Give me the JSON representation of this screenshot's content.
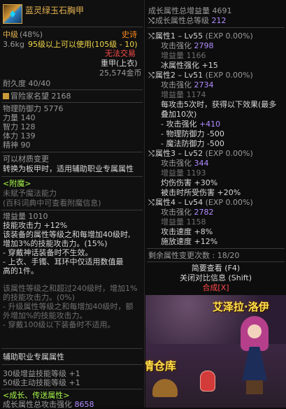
{
  "left": {
    "item_name": "蓝灵绿玉石胸甲",
    "grade": "中级",
    "grade_pct": "(48%)",
    "rarity": "史诗",
    "weight": "3.6kg",
    "level_req": "95级以上可以使用(105级 - 10)",
    "no_trade": "无法交易",
    "armor_type": "重甲(上衣)",
    "price": "25,574金币",
    "durability": "耐久度 40/40",
    "adventure_fame": "冒险家名望",
    "adventure_fame_value": "2168",
    "stats": [
      {
        "label": "物理防御力",
        "value": "5776"
      },
      {
        "label": "力量",
        "value": "140"
      },
      {
        "label": "智力",
        "value": "128"
      },
      {
        "label": "体力",
        "value": "139"
      },
      {
        "label": "精神",
        "value": "90"
      }
    ],
    "material_change": "可以材质变更",
    "convert": "转换为板甲时，适用辅助职业专属属性",
    "enchant_header": "<附魔>",
    "enchant_none": "未赋予魔法能力",
    "enchant_hint": "(百科词典中可查看附魔信息)",
    "bonus_label": "增益量",
    "bonus_value": "1010",
    "skill_atk": "技能攻击力 +12%",
    "desc_1": "该装备的属性等级之和每增加40级时,",
    "desc_2": "增加3%的技能攻击力。(15%)",
    "desc_3": "- 穿戴神话装备时不生效。",
    "desc_4": "- 上衣、手镯、耳环中仅适用数值最",
    "desc_5": "高的1件。",
    "desc_dim_1": "该属性等级之和超过240级时，增加1%",
    "desc_dim_2": "的技能攻击力。(0%)",
    "desc_dim_3": "- 升级属性等级之和每增加40级时，额",
    "desc_dim_4": "外增加%的技能攻击力。",
    "desc_dim_5": "- 穿戴100级以下装备时不适用。",
    "support_header": "辅助职业专属属性",
    "support_1": "30级增益技能等级 +1",
    "support_2": "50级主动技能等级 +1",
    "growth_header": "<成长、传送属性>",
    "growth_bottom": "成长属性总攻击强化",
    "growth_bottom_value": "8658"
  },
  "right": {
    "header_1": "成长属性总增益量",
    "header_1_value": "4691",
    "header_2": "成长属性总等级",
    "header_2_value": "212",
    "attr_1_title": "属性1 – Lv55",
    "attr_1_exp": "(EXP 0.00%)",
    "attr_1_atk_label": "攻击强化",
    "attr_1_atk": "2798",
    "attr_1_bonus_label": "增益量",
    "attr_1_bonus": "1166",
    "attr_1_effect": "冰属性强化 +15",
    "attr_2_title": "属性2 – Lv51",
    "attr_2_exp": "(EXP 0.00%)",
    "attr_2_atk_label": "攻击强化",
    "attr_2_atk": "2734",
    "attr_2_bonus_label": "增益量",
    "attr_2_bonus": "1174",
    "attr_2_effect_1": "每攻击5次时，获得以下效果(最多",
    "attr_2_effect_2": "叠加10次)",
    "attr_2_effect_3_label": "- 攻击强化",
    "attr_2_effect_3": "+410",
    "attr_2_effect_4": "- 物理防御力 -500",
    "attr_2_effect_5": "- 魔法防御力 -500",
    "attr_3_title": "属性3 – Lv52",
    "attr_3_exp": "(EXP 0.00%)",
    "attr_3_atk_label": "攻击强化",
    "attr_3_atk": "344",
    "attr_3_bonus_label": "增益量",
    "attr_3_bonus": "1193",
    "attr_3_effect_1": "灼伤伤害 +30%",
    "attr_3_effect_2": "被击时所受伤害 +20%",
    "attr_4_title": "属性4 – Lv54",
    "attr_4_exp": "(EXP 0.00%)",
    "attr_4_atk_label": "攻击强化",
    "attr_4_atk": "2782",
    "attr_4_bonus_label": "增益量",
    "attr_4_bonus": "1158",
    "attr_4_effect_1": "攻击速度 +8%",
    "attr_4_effect_2": "施放速度 +12%",
    "remaining": "剩余属性变更次数 : 18/20",
    "btn_brief": "简要查看 (F4)",
    "btn_close_compare": "关闭对比信息 (Shift)",
    "btn_synth": "合成[X]",
    "scene_text_a": "艾泽拉·洛伊",
    "scene_text_b": "情仓库"
  },
  "colors": {
    "rarity": "#ff8a1e",
    "item_name": "#e6b450",
    "accent_purple": "#b08cff",
    "accent_red": "#ff4a4a",
    "accent_green": "#5ccf62"
  }
}
